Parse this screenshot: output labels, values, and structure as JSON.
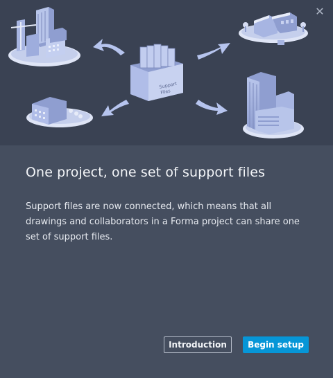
{
  "dialog": {
    "close_icon": "close-icon",
    "title": "One project, one set of support files",
    "description": "Support files are now connected, which means that all drawings and collaborators in a Forma project can share one set of support files.",
    "box_label_line1": "Support",
    "box_label_line2": "Files"
  },
  "buttons": {
    "introduction": "Introduction",
    "begin_setup": "Begin setup"
  },
  "colors": {
    "hero_background": "#3a4253",
    "body_background": "#454e5f",
    "primary_button": "#0696d7"
  }
}
